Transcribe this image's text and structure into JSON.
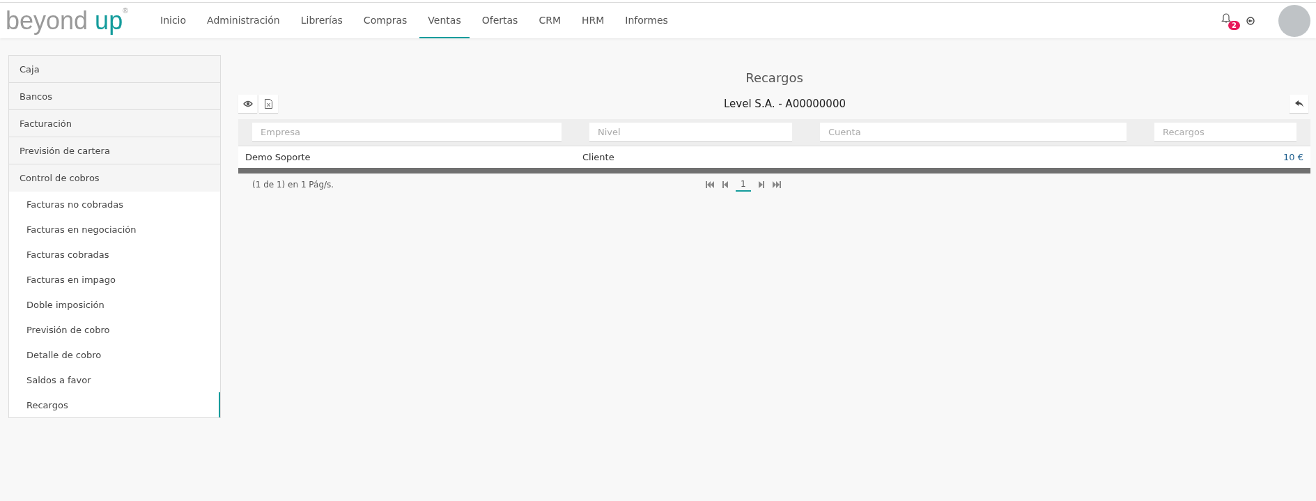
{
  "logo": {
    "main": "beyond",
    "accent": "up",
    "mark": "®"
  },
  "nav": [
    {
      "label": "Inicio",
      "selected": false
    },
    {
      "label": "Administración",
      "selected": false
    },
    {
      "label": "Librerías",
      "selected": false
    },
    {
      "label": "Compras",
      "selected": false
    },
    {
      "label": "Ventas",
      "selected": true
    },
    {
      "label": "Ofertas",
      "selected": false
    },
    {
      "label": "CRM",
      "selected": false
    },
    {
      "label": "HRM",
      "selected": false
    },
    {
      "label": "Informes",
      "selected": false
    }
  ],
  "notifications": {
    "count": "2"
  },
  "sidebar": {
    "items": [
      {
        "label": "Caja",
        "expanded": false
      },
      {
        "label": "Bancos",
        "expanded": false
      },
      {
        "label": "Facturación",
        "expanded": false
      },
      {
        "label": "Previsión de cartera",
        "expanded": false
      },
      {
        "label": "Control de cobros",
        "expanded": true,
        "children": [
          {
            "label": "Facturas no cobradas",
            "selected": false
          },
          {
            "label": "Facturas en negociación",
            "selected": false
          },
          {
            "label": "Facturas cobradas",
            "selected": false
          },
          {
            "label": "Facturas en impago",
            "selected": false
          },
          {
            "label": "Doble imposición",
            "selected": false
          },
          {
            "label": "Previsión de cobro",
            "selected": false
          },
          {
            "label": "Detalle de cobro",
            "selected": false
          },
          {
            "label": "Saldos a favor",
            "selected": false
          },
          {
            "label": "Recargos",
            "selected": true
          }
        ]
      }
    ]
  },
  "page": {
    "title": "Recargos",
    "subtitle": "Level S.A. - A00000000"
  },
  "table": {
    "filters": [
      {
        "placeholder": "Empresa"
      },
      {
        "placeholder": "Nivel"
      },
      {
        "placeholder": "Cuenta"
      },
      {
        "placeholder": "Recargos"
      }
    ],
    "rows": [
      {
        "cells": [
          "Demo Soporte",
          "Cliente",
          "",
          "10 €"
        ]
      }
    ]
  },
  "pagination": {
    "summary": "(1 de 1) en 1 Pág/s.",
    "pages": [
      {
        "label": "1",
        "selected": true
      }
    ]
  }
}
